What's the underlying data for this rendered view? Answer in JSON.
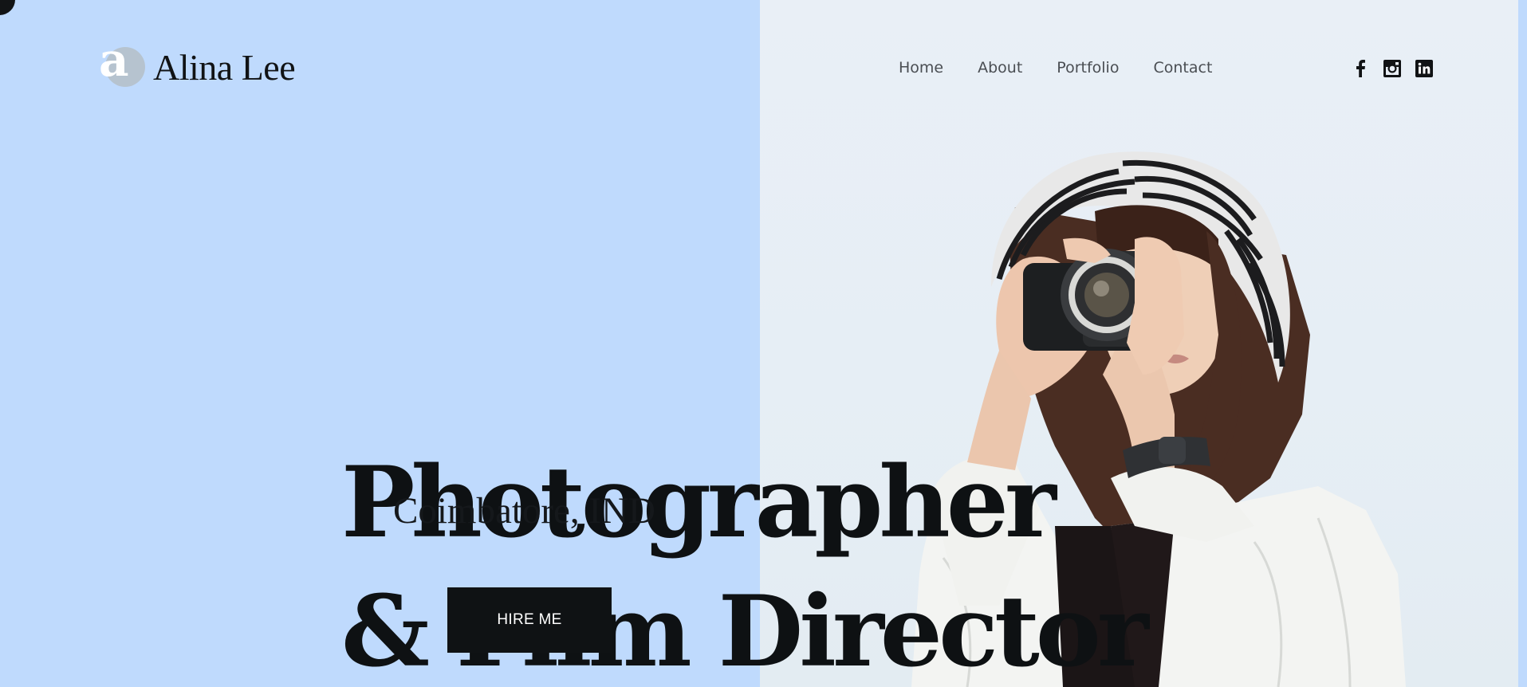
{
  "brand": {
    "logo_letter": "a",
    "name": "Alina Lee"
  },
  "nav": {
    "items": [
      {
        "label": "Home"
      },
      {
        "label": "About"
      },
      {
        "label": "Portfolio"
      },
      {
        "label": "Contact"
      }
    ]
  },
  "social": [
    {
      "icon": "facebook-icon"
    },
    {
      "icon": "instagram-icon"
    },
    {
      "icon": "linkedin-icon"
    }
  ],
  "hero": {
    "title_line1": "Photographer",
    "title_line2": "& Film Director",
    "location": "Coimbatore, IND",
    "cta_label": "HIRE ME",
    "image": "woman-with-camera-photo"
  },
  "colors": {
    "left_background": "#bfdafd",
    "right_background": "#e7eef5",
    "text_dark": "#0e1113",
    "button_background": "#0f1214",
    "nav_text": "#4a4e53"
  }
}
